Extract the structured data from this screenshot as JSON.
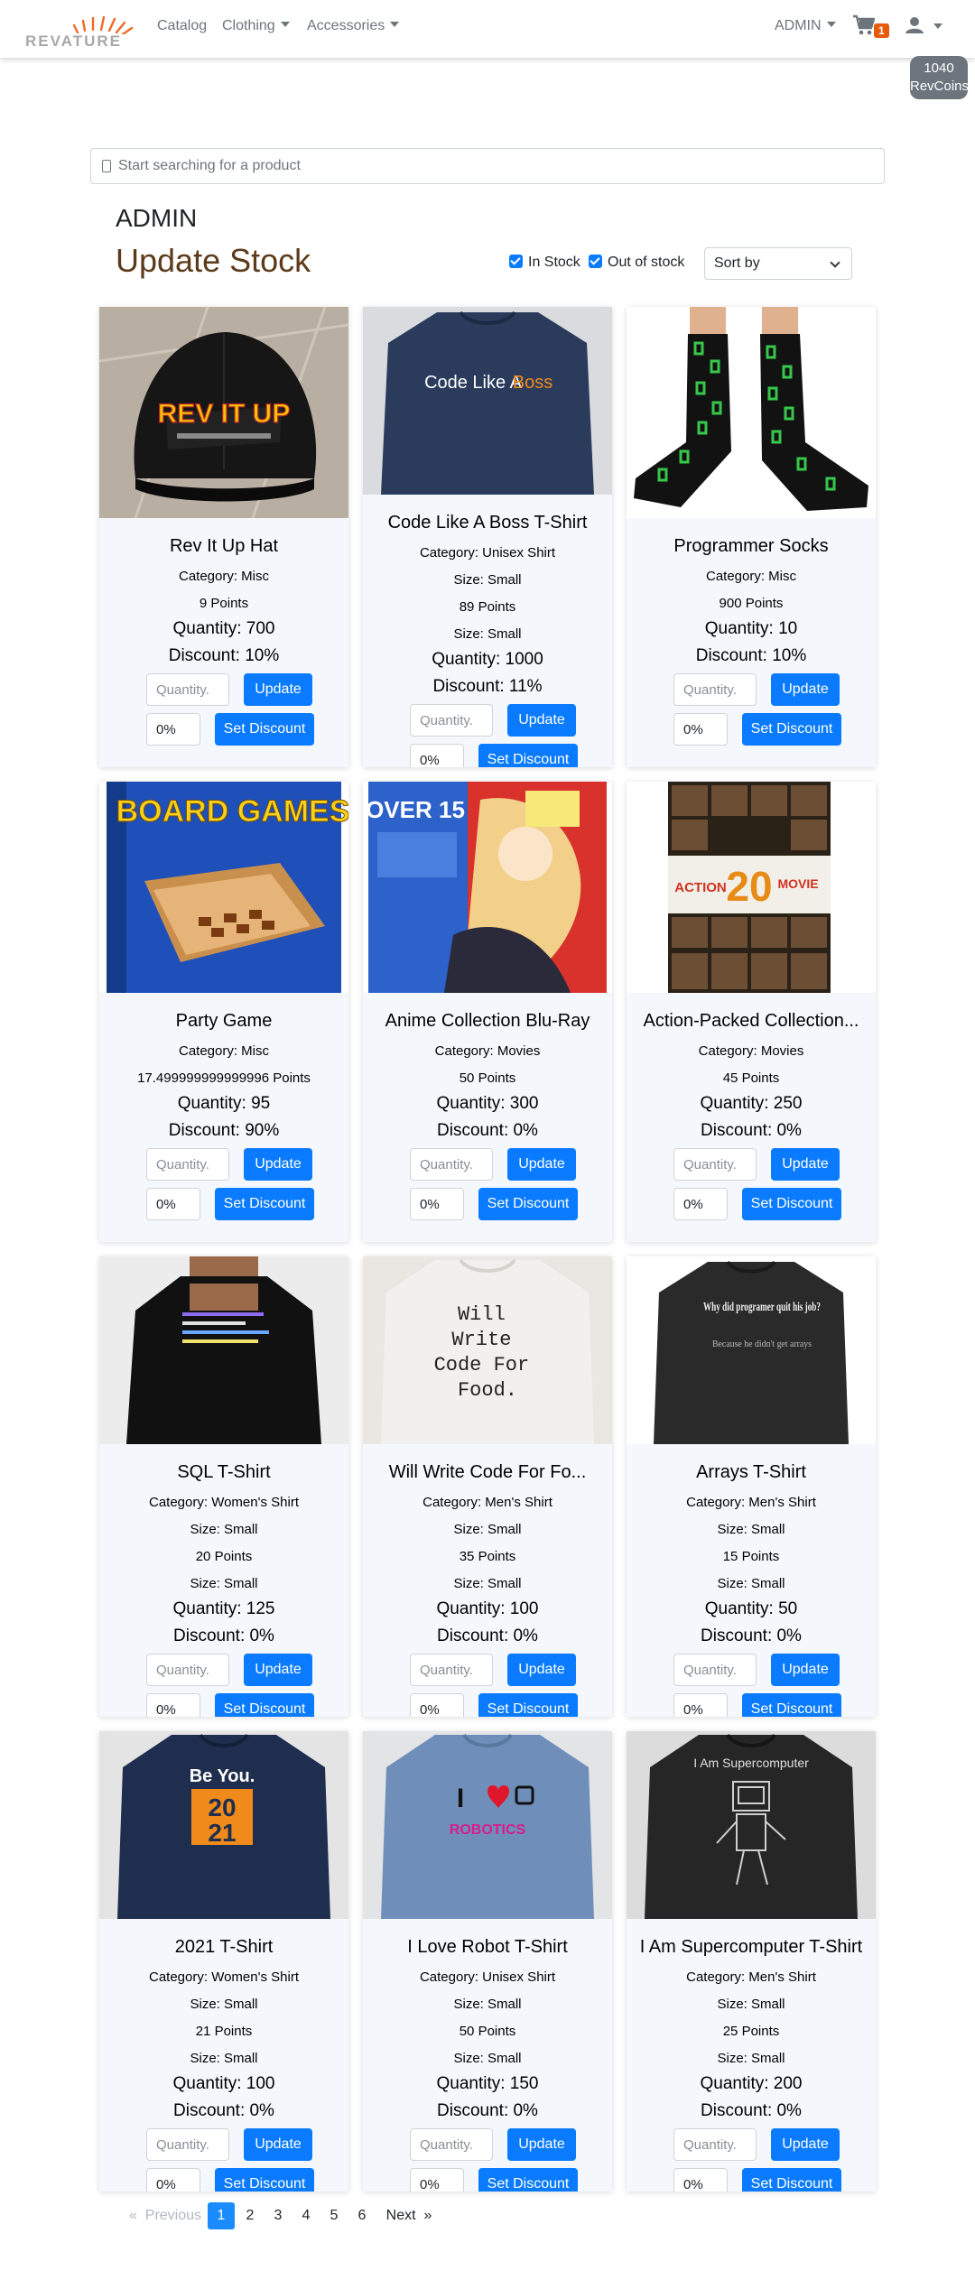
{
  "navbar": {
    "logo_text": "REVATURE",
    "links": [
      {
        "label": "Catalog",
        "has_caret": false
      },
      {
        "label": "Clothing",
        "has_caret": true
      },
      {
        "label": "Accessories",
        "has_caret": true
      }
    ],
    "user_label": "ADMIN",
    "cart_count": "1",
    "revcoins_amount": "1040",
    "revcoins_label": "RevCoins"
  },
  "search": {
    "placeholder": "Start searching for a product"
  },
  "role": "ADMIN",
  "title": "Update Stock",
  "filters": {
    "in_stock": "In Stock",
    "out_of_stock": "Out of stock",
    "sort_label": "Sort by"
  },
  "card_controls": {
    "quantity_placeholder": "Quantity.",
    "update_label": "Update",
    "set_discount_label": "Set Discount"
  },
  "products": [
    {
      "name": "Rev It Up Hat",
      "category": "Category: Misc",
      "size": "",
      "points": "9 Points",
      "size2": "",
      "quantity": "Quantity: 700",
      "discount": "Discount: 10%",
      "discount_value": "0%",
      "image": "black-cap"
    },
    {
      "name": "Code Like A Boss T-Shirt",
      "category": "Category: Unisex Shirt",
      "size": "Size: Small",
      "points": "89 Points",
      "size2": "Size: Small",
      "quantity": "Quantity: 1000",
      "discount": "Discount: 11%",
      "discount_value": "0%",
      "image": "navy-shirt-code-like-a-boss"
    },
    {
      "name": "Programmer Socks",
      "category": "Category: Misc",
      "size": "",
      "points": "900 Points",
      "size2": "",
      "quantity": "Quantity: 10",
      "discount": "Discount: 10%",
      "discount_value": "0%",
      "image": "green-binary-socks"
    },
    {
      "name": "Party Game",
      "category": "Category: Misc",
      "size": "",
      "points": "17.499999999999996 Points",
      "size2": "",
      "quantity": "Quantity: 95",
      "discount": "Discount: 90%",
      "discount_value": "0%",
      "image": "board-games-box"
    },
    {
      "name": "Anime Collection Blu-Ray",
      "category": "Category: Movies",
      "size": "",
      "points": "50 Points",
      "size2": "",
      "quantity": "Quantity: 300",
      "discount": "Discount: 0%",
      "discount_value": "0%",
      "image": "anime-bluray-cover"
    },
    {
      "name": "Action-Packed Collection...",
      "category": "Category: Movies",
      "size": "",
      "points": "45 Points",
      "size2": "",
      "quantity": "Quantity: 250",
      "discount": "Discount: 0%",
      "discount_value": "0%",
      "image": "action-movie-collection"
    },
    {
      "name": "SQL T-Shirt",
      "category": "Category: Women's Shirt",
      "size": "Size: Small",
      "points": "20 Points",
      "size2": "Size: Small",
      "quantity": "Quantity: 125",
      "discount": "Discount: 0%",
      "discount_value": "0%",
      "image": "black-sql-shirt"
    },
    {
      "name": "Will Write Code For Fo...",
      "category": "Category: Men's Shirt",
      "size": "Size: Small",
      "points": "35 Points",
      "size2": "Size: Small",
      "quantity": "Quantity: 100",
      "discount": "Discount: 0%",
      "discount_value": "0%",
      "image": "white-will-write-code-shirt"
    },
    {
      "name": "Arrays T-Shirt",
      "category": "Category: Men's Shirt",
      "size": "Size: Small",
      "points": "15 Points",
      "size2": "Size: Small",
      "quantity": "Quantity: 50",
      "discount": "Discount: 0%",
      "discount_value": "0%",
      "image": "black-arrays-shirt"
    },
    {
      "name": "2021 T-Shirt",
      "category": "Category: Women's Shirt",
      "size": "Size: Small",
      "points": "21 Points",
      "size2": "Size: Small",
      "quantity": "Quantity: 100",
      "discount": "Discount: 0%",
      "discount_value": "0%",
      "image": "navy-2021-shirt"
    },
    {
      "name": "I Love Robot T-Shirt",
      "category": "Category: Unisex Shirt",
      "size": "Size: Small",
      "points": "50 Points",
      "size2": "Size: Small",
      "quantity": "Quantity: 150",
      "discount": "Discount: 0%",
      "discount_value": "0%",
      "image": "blue-robot-shirt"
    },
    {
      "name": "I Am Supercomputer T-Shirt",
      "category": "Category: Men's Shirt",
      "size": "Size: Small",
      "points": "25 Points",
      "size2": "Size: Small",
      "quantity": "Quantity: 200",
      "discount": "Discount: 0%",
      "discount_value": "0%",
      "image": "black-supercomputer-shirt"
    }
  ],
  "image_text": {
    "rev_it_up": "REV IT UP",
    "code_like": "Code Like A",
    "boss": "Boss",
    "board_games": "BOARD GAMES",
    "over15": "OVER 15",
    "action": "ACTION",
    "twenty": "20",
    "movie": "MOVIE",
    "will_write": "Will\nWrite\nCode For\nFood.",
    "why_did": "Why did programer quit his job?",
    "because": "Because he didn't get arrays",
    "be_you": "Be You.",
    "year_top": "20",
    "year_bottom": "21",
    "robotics": "ROBOTICS",
    "i_letter": "I",
    "supercomputer": "I Am Supercomputer"
  },
  "pagination": {
    "previous": "Previous",
    "pages": [
      "1",
      "2",
      "3",
      "4",
      "5",
      "6"
    ],
    "active": "1",
    "next": "Next"
  }
}
